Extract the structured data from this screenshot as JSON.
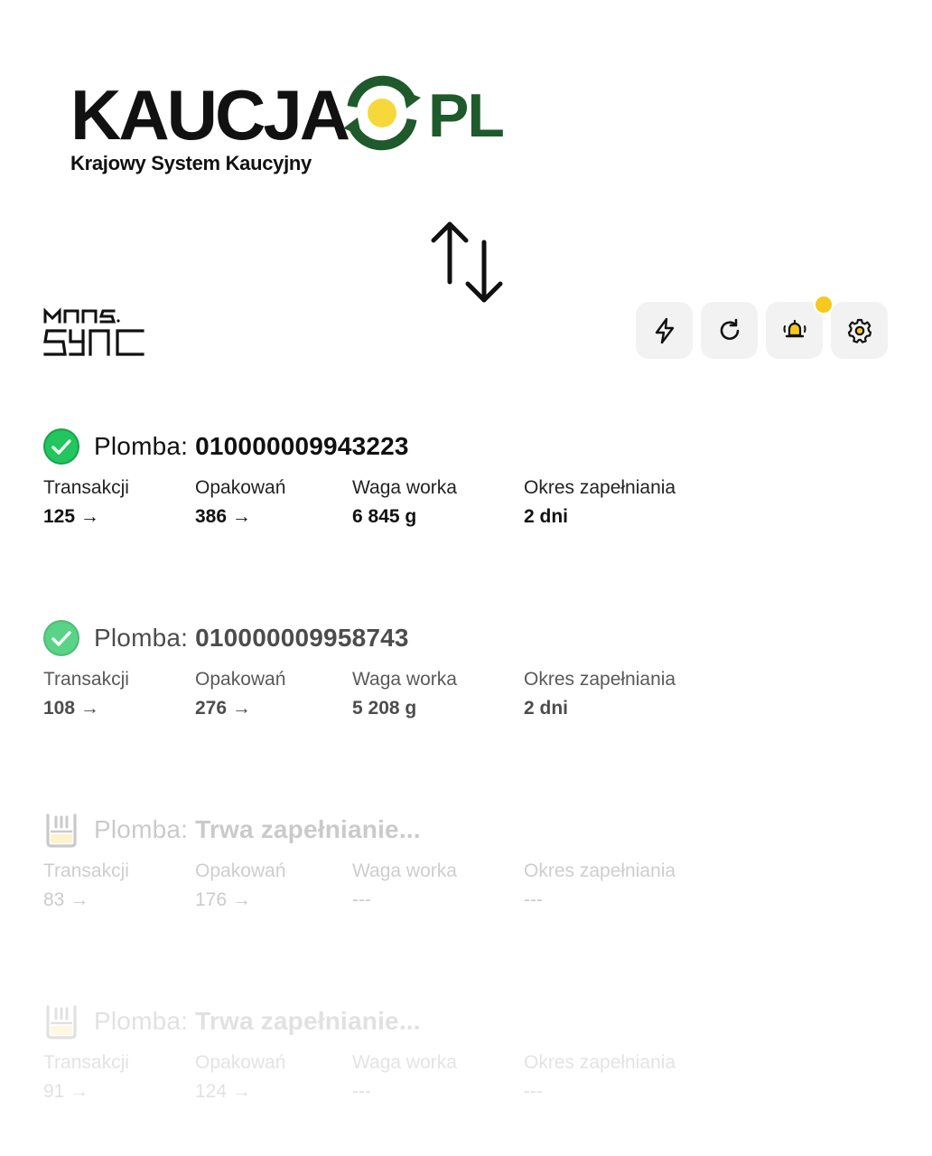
{
  "logo": {
    "brand_left": "KAUCJA",
    "brand_right": "PL",
    "subtitle": "Krajowy System Kaucyjny",
    "brand_colors": {
      "dark": "#111111",
      "green": "#1e5a2b",
      "yellow": "#f7d83a"
    }
  },
  "partner_logo": {
    "line1": "MAAS",
    "line2": "SYNC"
  },
  "toolbar": {
    "buttons": [
      {
        "icon": "lightning-icon"
      },
      {
        "icon": "refresh-icon"
      },
      {
        "icon": "alarm-bell-icon",
        "has_notification": true
      },
      {
        "icon": "gear-icon"
      }
    ],
    "notification_color": "#f7c81e"
  },
  "seals": [
    {
      "status": "complete",
      "label": "Plomba:",
      "value": "010000009943223",
      "stats": {
        "transactions_label": "Transakcji",
        "transactions_value": "125 →",
        "packages_label": "Opakowań",
        "packages_value": "386 →",
        "weight_label": "Waga worka",
        "weight_value": "6 845 g",
        "period_label": "Okres zapełniania",
        "period_value": "2 dni"
      }
    },
    {
      "status": "complete",
      "label": "Plomba:",
      "value": "010000009958743",
      "stats": {
        "transactions_label": "Transakcji",
        "transactions_value": "108 →",
        "packages_label": "Opakowań",
        "packages_value": "276 →",
        "weight_label": "Waga worka",
        "weight_value": "5 208 g",
        "period_label": "Okres zapełniania",
        "period_value": "2 dni"
      }
    },
    {
      "status": "filling",
      "label": "Plomba:",
      "value": "Trwa zapełnianie...",
      "stats": {
        "transactions_label": "Transakcji",
        "transactions_value": "83 →",
        "packages_label": "Opakowań",
        "packages_value": "176 →",
        "weight_label": "Waga worka",
        "weight_value": "---",
        "period_label": "Okres zapełniania",
        "period_value": "---"
      }
    },
    {
      "status": "filling",
      "label": "Plomba:",
      "value": "Trwa zapełnianie...",
      "stats": {
        "transactions_label": "Transakcji",
        "transactions_value": "91 →",
        "packages_label": "Opakowań",
        "packages_value": "124 →",
        "weight_label": "Waga worka",
        "weight_value": "---",
        "period_label": "Okres zapełniania",
        "period_value": "---"
      }
    }
  ]
}
